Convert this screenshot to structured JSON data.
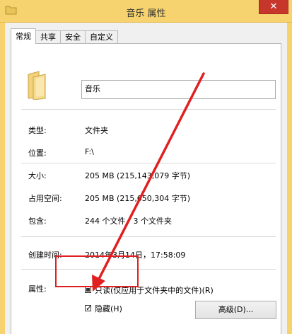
{
  "window": {
    "title": "音乐 属性",
    "close_glyph": "✕"
  },
  "tabs": [
    {
      "label": "常规",
      "active": true
    },
    {
      "label": "共享",
      "active": false
    },
    {
      "label": "安全",
      "active": false
    },
    {
      "label": "自定义",
      "active": false
    }
  ],
  "general": {
    "name": "音乐",
    "rows": [
      {
        "label": "类型:",
        "value": "文件夹"
      },
      {
        "label": "位置:",
        "value": "F:\\"
      },
      {
        "label": "大小:",
        "value": "205 MB (215,143,079 字节)"
      },
      {
        "label": "占用空间:",
        "value": "205 MB (215,650,304 字节)"
      },
      {
        "label": "包含:",
        "value": "244 个文件，3 个文件夹"
      },
      {
        "label": "创建时间:",
        "value": "2014年3月14日，17:58:09"
      }
    ],
    "attributes_label": "属性:",
    "readonly_label": "只读(仅应用于文件夹中的文件)(R)",
    "readonly_state": "partial",
    "hidden_label": "隐藏(H)",
    "hidden_checked": true,
    "advanced_button": "高级(D)..."
  },
  "annotation": {
    "color": "#e02020"
  }
}
